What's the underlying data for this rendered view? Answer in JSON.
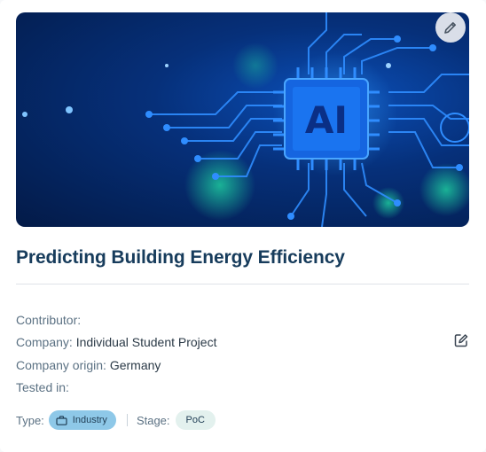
{
  "project": {
    "title": "Predicting Building Energy Efficiency",
    "hero_image_alt": "AI chip circuit board",
    "hero_image_text": "AI",
    "edit_icon": "pencil-icon"
  },
  "details": {
    "contributor_label": "Contributor:",
    "contributor_value": "",
    "company_label": "Company:",
    "company_value": "Individual Student Project",
    "origin_label": "Company origin:",
    "origin_value": "Germany",
    "tested_label": "Tested in:",
    "tested_value": "",
    "edit_icon": "edit-icon"
  },
  "tags": {
    "type_label": "Type:",
    "type_value": "Industry",
    "type_icon": "briefcase-icon",
    "stage_label": "Stage:",
    "stage_value": "PoC"
  },
  "colors": {
    "title": "#173c5c",
    "type_chip": "#8ec8e8",
    "stage_chip": "#e3f1ee"
  }
}
